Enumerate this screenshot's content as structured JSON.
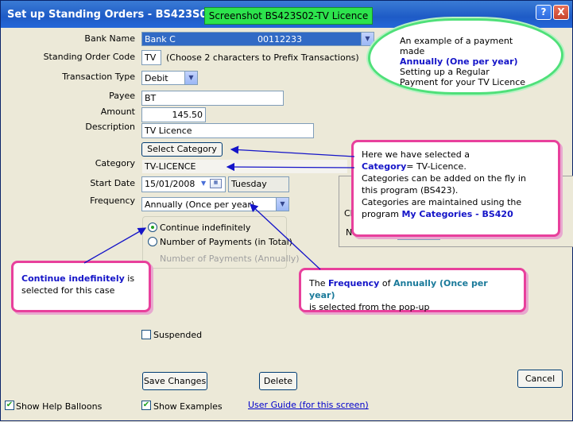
{
  "window": {
    "title": "Set up Standing Orders - BS423S02",
    "screenshot_tag": "Screenshot BS423S02-TV Licence",
    "help_label": "?",
    "close_label": "X"
  },
  "form": {
    "bank_name_label": "Bank Name",
    "bank_name_value": "Bank C",
    "bank_account_value": "00112233",
    "code_label": "Standing Order Code",
    "code_value": "TV",
    "code_hint": "(Choose 2 characters to Prefix Transactions)",
    "type_label": "Transaction Type",
    "type_value": "Debit",
    "payee_label": "Payee",
    "payee_value": "BT",
    "amount_label": "Amount",
    "amount_value": "145.50",
    "description_label": "Description",
    "description_value": "TV Licence",
    "select_category_label": "Select Category",
    "category_label": "Category",
    "category_value": "TV-LICENCE",
    "start_date_label": "Start Date",
    "start_date_value": "15/01/2008",
    "start_day_value": "Tuesday",
    "frequency_label": "Frequency",
    "frequency_value": "Annually (Once per year)",
    "continue_label": "Continue indefinitely",
    "number_label": "Number of Payments (in Total)",
    "number_annual_label": "Number of Payments (Annually)",
    "suspended_label": "Suspended",
    "save_label": "Save Changes",
    "delete_label": "Delete",
    "cancel_label": "Cancel",
    "show_help_label": "Show Help Balloons",
    "show_examples_label": "Show Examples",
    "user_guide_label": "User Guide (for this screen)"
  },
  "hidden_panel": {
    "fragment_a": "Cl",
    "fragment_b": "N"
  },
  "cloud": {
    "line1": "An example of a payment",
    "line2": "made",
    "line3": "Annually (One per year)",
    "line4": "Setting up a Regular",
    "line5": "Payment for your TV Licence"
  },
  "callout_category": {
    "line1": "Here we have selected a",
    "cat_word": "Category",
    "cat_rest": "= TV-Licence.",
    "line3": "Categories can be added on the fly in",
    "line4": "this program (BS423).",
    "line5": "Categories are maintained using the",
    "line6a": "program ",
    "line6b": "My Categories - BS420"
  },
  "callout_continue": {
    "bold": "Continue indefinitely",
    "rest1": " is",
    "line2": "selected for this case"
  },
  "callout_frequency": {
    "pre": "The ",
    "word1": "Frequency",
    "mid": " of ",
    "word2": "Annually (Once per year)",
    "line2": "is selected from the pop-up"
  },
  "colors": {
    "accent_pink": "#E8409C",
    "cloud_green": "#4FE079",
    "title_blue": "#1E5BC6",
    "highlight_blue": "#1414C8"
  }
}
